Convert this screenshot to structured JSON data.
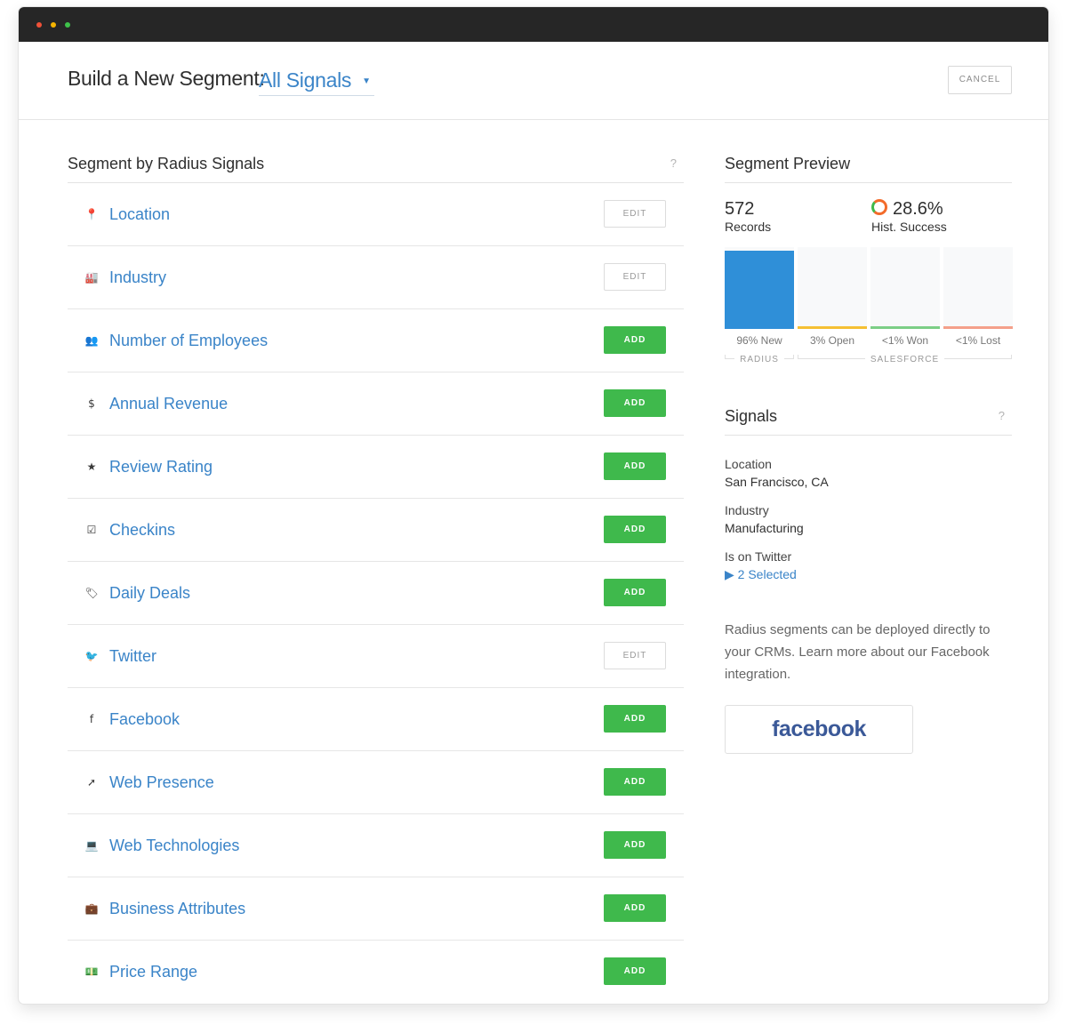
{
  "header": {
    "title": "Build a New Segment:",
    "segment_type": "All Signals",
    "cancel_label": "CANCEL"
  },
  "left": {
    "title": "Segment by Radius Signals",
    "help": "?",
    "rows": [
      {
        "label": "Location",
        "icon": "map-pin-icon",
        "glyph": "📍",
        "action": "EDIT"
      },
      {
        "label": "Industry",
        "icon": "factory-icon",
        "glyph": "🏭",
        "action": "EDIT"
      },
      {
        "label": "Number of Employees",
        "icon": "people-icon",
        "glyph": "👥",
        "action": "ADD"
      },
      {
        "label": "Annual Revenue",
        "icon": "dollar-coin-icon",
        "glyph": "$",
        "action": "ADD"
      },
      {
        "label": "Review Rating",
        "icon": "star-icon",
        "glyph": "★",
        "action": "ADD"
      },
      {
        "label": "Checkins",
        "icon": "checklist-icon",
        "glyph": "☑",
        "action": "ADD"
      },
      {
        "label": "Daily Deals",
        "icon": "tag-icon",
        "glyph": "🏷",
        "action": "ADD"
      },
      {
        "label": "Twitter",
        "icon": "twitter-icon",
        "glyph": "🐦",
        "action": "EDIT"
      },
      {
        "label": "Facebook",
        "icon": "facebook-icon",
        "glyph": "f",
        "action": "ADD"
      },
      {
        "label": "Web Presence",
        "icon": "cursor-icon",
        "glyph": "➚",
        "action": "ADD"
      },
      {
        "label": "Web Technologies",
        "icon": "laptop-icon",
        "glyph": "💻",
        "action": "ADD"
      },
      {
        "label": "Business Attributes",
        "icon": "briefcase-icon",
        "glyph": "💼",
        "action": "ADD"
      },
      {
        "label": "Price Range",
        "icon": "money-icon",
        "glyph": "💵",
        "action": "ADD"
      }
    ]
  },
  "preview": {
    "title": "Segment Preview",
    "records_value": "572",
    "records_label": "Records",
    "success_value": "28.6%",
    "success_label": "Hist. Success",
    "bars": [
      {
        "label": "96% New",
        "fraction": 0.96,
        "color": "#2f8fd8"
      },
      {
        "label": "3% Open",
        "fraction": 0.03,
        "color": "#f5c033"
      },
      {
        "label": "<1% Won",
        "fraction": 0.01,
        "color": "#7ccf86"
      },
      {
        "label": "<1% Lost",
        "fraction": 0.01,
        "color": "#f4a08a"
      }
    ],
    "group_radius": "RADIUS",
    "group_salesforce": "SALESFORCE"
  },
  "signals": {
    "title": "Signals",
    "help": "?",
    "location_key": "Location",
    "location_value": "San Francisco, CA",
    "industry_key": "Industry",
    "industry_value": "Manufacturing",
    "twitter_key": "Is on Twitter",
    "twitter_value": "▶ 2 Selected",
    "note": "Radius segments can be deployed directly to your CRMs. Learn more about our Facebook integration.",
    "facebook_button": "facebook"
  },
  "colors": {
    "accent": "#3a84c8",
    "add_green": "#3fb94c",
    "titlebar": "#262626"
  }
}
